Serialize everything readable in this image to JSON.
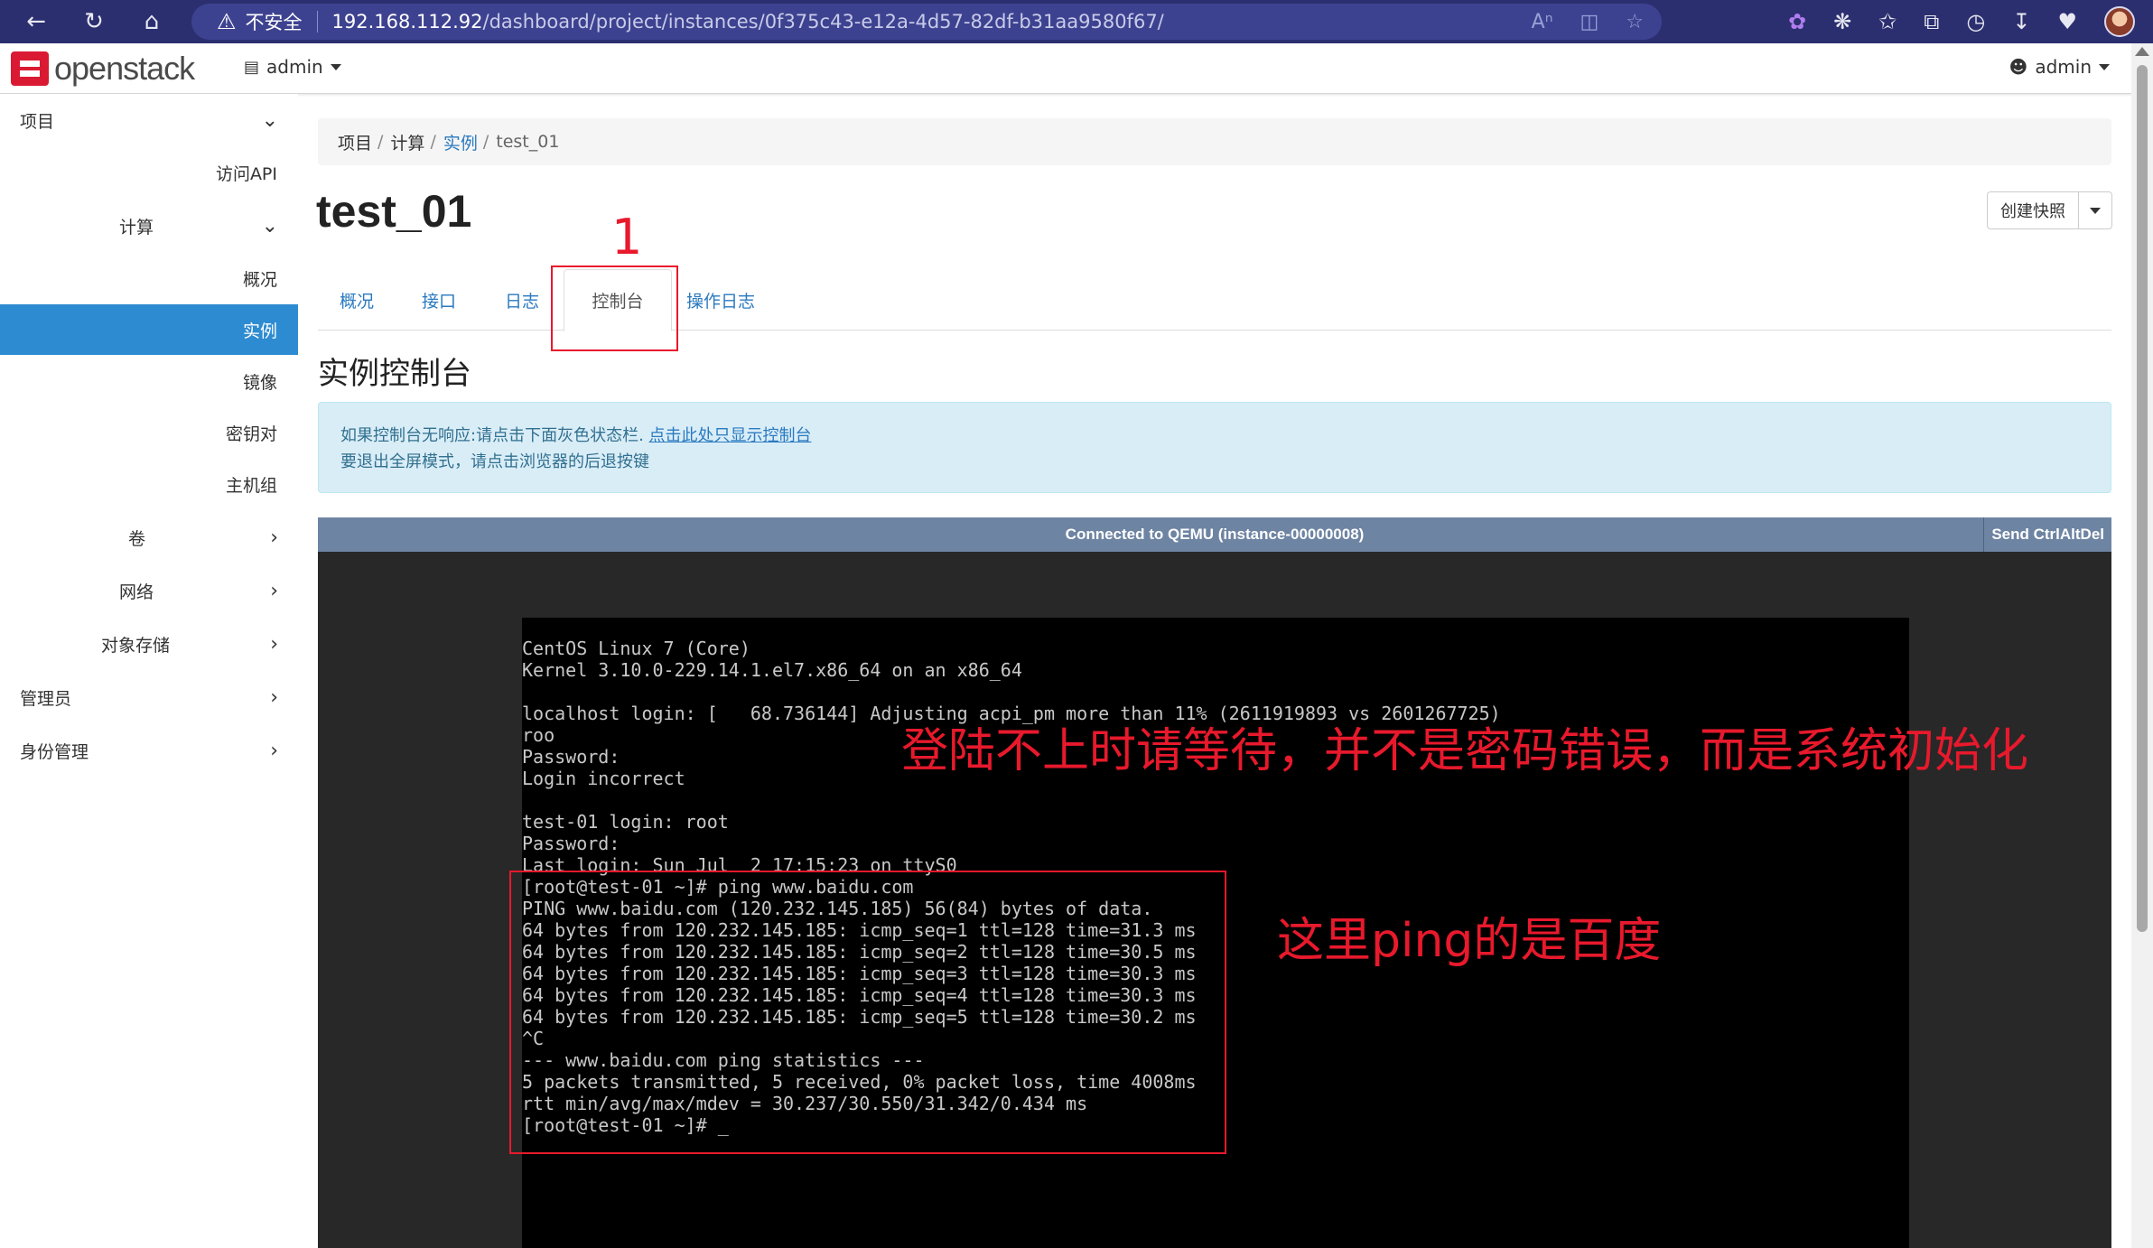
{
  "browser": {
    "warning": "不安全",
    "url_host": "192.168.112.92",
    "url_path": "/dashboard/project/instances/0f375c43-e12a-4d57-82df-b31aa9580f67/"
  },
  "topbar": {
    "logo": "openstack",
    "project": "admin",
    "user": "admin"
  },
  "sidebar": {
    "items": [
      {
        "label": "项目"
      },
      {
        "label": "访问API"
      },
      {
        "label": "计算"
      },
      {
        "label": "概况"
      },
      {
        "label": "实例"
      },
      {
        "label": "镜像"
      },
      {
        "label": "密钥对"
      },
      {
        "label": "主机组"
      },
      {
        "label": "卷"
      },
      {
        "label": "网络"
      },
      {
        "label": "对象存储"
      },
      {
        "label": "管理员"
      },
      {
        "label": "身份管理"
      }
    ]
  },
  "breadcrumb": {
    "items": [
      "项目",
      "计算",
      "实例",
      "test_01"
    ]
  },
  "page": {
    "title": "test_01",
    "snapshot_label": "创建快照",
    "section_title": "实例控制台"
  },
  "tabs": [
    "概况",
    "接口",
    "日志",
    "控制台",
    "操作日志"
  ],
  "info": {
    "line1_prefix": "如果控制台无响应:请点击下面灰色状态栏. ",
    "line1_link": "点击此处只显示控制台",
    "line2": "要退出全屏模式，请点击浏览器的后退按键"
  },
  "console": {
    "status": "Connected to QEMU (instance-00000008)",
    "cad_label": "Send CtrlAltDel",
    "lines": [
      "CentOS Linux 7 (Core)",
      "Kernel 3.10.0-229.14.1.el7.x86_64 on an x86_64",
      "",
      "localhost login: [   68.736144] Adjusting acpi_pm more than 11% (2611919893 vs 2601267725)",
      "roo",
      "Password:",
      "Login incorrect",
      "",
      "test-01 login: root",
      "Password:",
      "Last login: Sun Jul  2 17:15:23 on ttyS0",
      "[root@test-01 ~]# ping www.baidu.com",
      "PING www.baidu.com (120.232.145.185) 56(84) bytes of data.",
      "64 bytes from 120.232.145.185: icmp_seq=1 ttl=128 time=31.3 ms",
      "64 bytes from 120.232.145.185: icmp_seq=2 ttl=128 time=30.5 ms",
      "64 bytes from 120.232.145.185: icmp_seq=3 ttl=128 time=30.3 ms",
      "64 bytes from 120.232.145.185: icmp_seq=4 ttl=128 time=30.3 ms",
      "64 bytes from 120.232.145.185: icmp_seq=5 ttl=128 time=30.2 ms",
      "^C",
      "--- www.baidu.com ping statistics ---",
      "5 packets transmitted, 5 received, 0% packet loss, time 4008ms",
      "rtt min/avg/max/mdev = 30.237/30.550/31.342/0.434 ms",
      "[root@test-01 ~]# _"
    ]
  },
  "annotations": {
    "number": "1",
    "note_login": "登陆不上时请等待，并不是密码错误，而是系统初始化",
    "note_ping": "这里ping的是百度"
  },
  "colors": {
    "browser_bar": "#2b2f6f",
    "sidebar_active": "#2d8bd1",
    "link": "#2a7ac0",
    "annotation_red": "#e8192c"
  }
}
